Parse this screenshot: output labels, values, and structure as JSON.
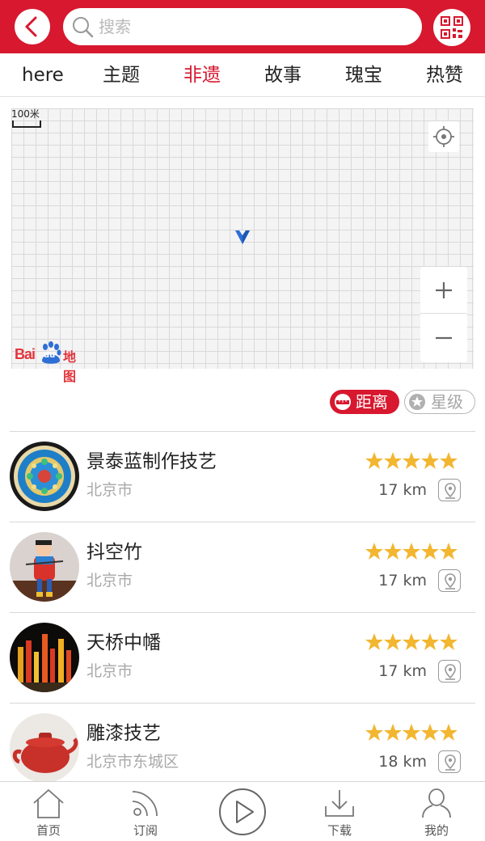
{
  "header": {
    "search_placeholder": "搜索",
    "accent_color": "#d7182f"
  },
  "tabs": [
    {
      "label": "here",
      "active": false
    },
    {
      "label": "主题",
      "active": false
    },
    {
      "label": "非遗",
      "active": true
    },
    {
      "label": "故事",
      "active": false
    },
    {
      "label": "瑰宝",
      "active": false
    },
    {
      "label": "热赞",
      "active": false
    }
  ],
  "map": {
    "scale_label": "100米",
    "logo_text": "Bai",
    "logo_du": "du",
    "logo_map": "地图"
  },
  "sort": {
    "distance_label": "距离",
    "stars_label": "星级"
  },
  "items": [
    {
      "title": "景泰蓝制作技艺",
      "location": "北京市",
      "distance": "17 km",
      "stars": 5
    },
    {
      "title": "抖空竹",
      "location": "北京市",
      "distance": "17 km",
      "stars": 5
    },
    {
      "title": "天桥中幡",
      "location": "北京市",
      "distance": "17 km",
      "stars": 5
    },
    {
      "title": "雕漆技艺",
      "location": "北京市东城区",
      "distance": "18 km",
      "stars": 5
    }
  ],
  "bottom_nav": {
    "home": "首页",
    "subscribe": "订阅",
    "download": "下载",
    "mine": "我的"
  },
  "icons": [
    "back-icon",
    "search-icon",
    "qr-code-icon",
    "locate-icon",
    "navigation-arrow-icon",
    "zoom-in-icon",
    "zoom-out-icon",
    "ruler-icon",
    "star-badge-icon",
    "star-icon",
    "map-pin-icon",
    "home-icon",
    "rss-icon",
    "play-icon",
    "download-icon",
    "user-icon"
  ]
}
